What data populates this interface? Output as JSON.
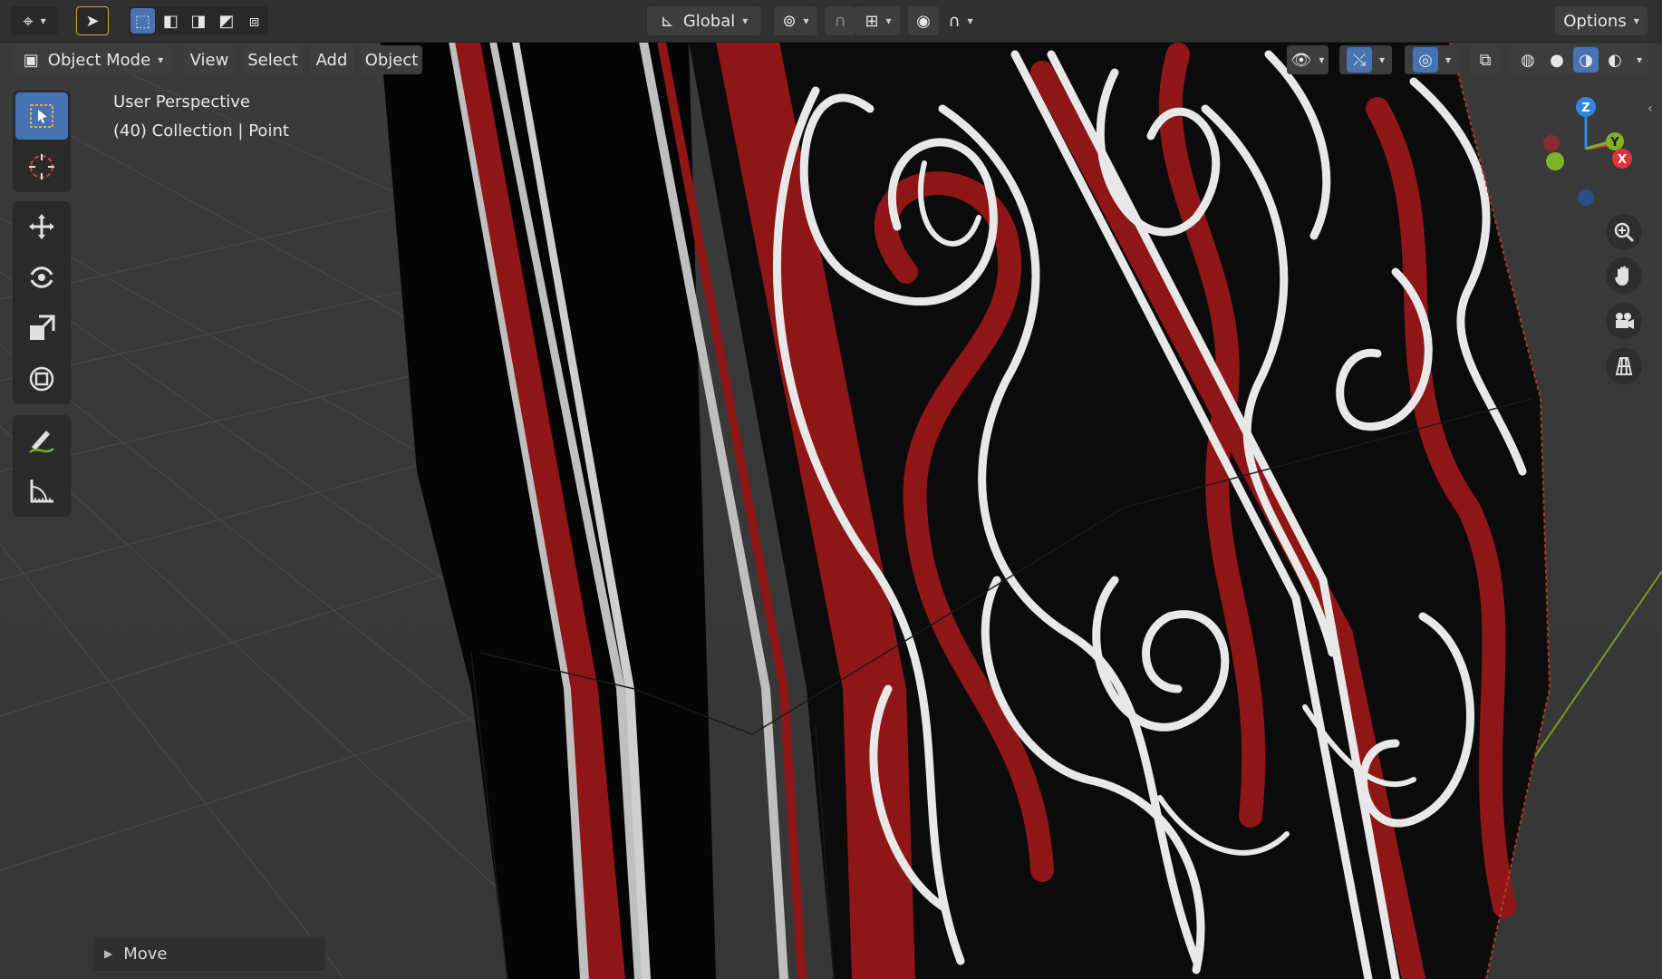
{
  "header": {
    "transform_orientation": "Global",
    "options_label": "Options",
    "icons": [
      "editor-type-icon",
      "select-tool-icon",
      "box-select-new-icon",
      "box-select-extend-icon",
      "box-select-subtract-icon",
      "box-select-invert-icon",
      "box-select-intersect-icon",
      "orientation-axes-icon",
      "pivot-point-icon",
      "snap-magnet-icon",
      "snap-increment-icon",
      "proportional-editing-icon",
      "falloff-curve-icon"
    ]
  },
  "menu": {
    "mode": "Object Mode",
    "view": "View",
    "select": "Select",
    "add": "Add",
    "object": "Object"
  },
  "overlay": {
    "perspective": "User Perspective",
    "collection": "(40) Collection | Point"
  },
  "toolbar": {
    "tools": [
      "select-box-icon",
      "cursor-icon",
      "move-icon",
      "rotate-icon",
      "scale-icon",
      "transform-icon",
      "annotate-icon",
      "measure-icon"
    ],
    "active_tool": "select-box-icon"
  },
  "shading": {
    "modes": [
      "wireframe-icon",
      "solid-icon",
      "material-preview-icon",
      "rendered-icon"
    ],
    "active_mode": "material-preview-icon"
  },
  "gizmo": {
    "axes": [
      "Z",
      "Y",
      "X"
    ],
    "colors": {
      "x": "#e2323d",
      "y": "#7eb227",
      "z": "#2f85e6"
    }
  },
  "navigation": [
    "zoom-icon",
    "pan-hand-icon",
    "camera-view-icon",
    "ortho-grid-icon"
  ],
  "last_operation": {
    "label": "Move"
  },
  "colors": {
    "accent": "#4772b3",
    "texture_red": "#8f1617",
    "texture_white": "#e8e8e8",
    "texture_black": "#000000"
  }
}
